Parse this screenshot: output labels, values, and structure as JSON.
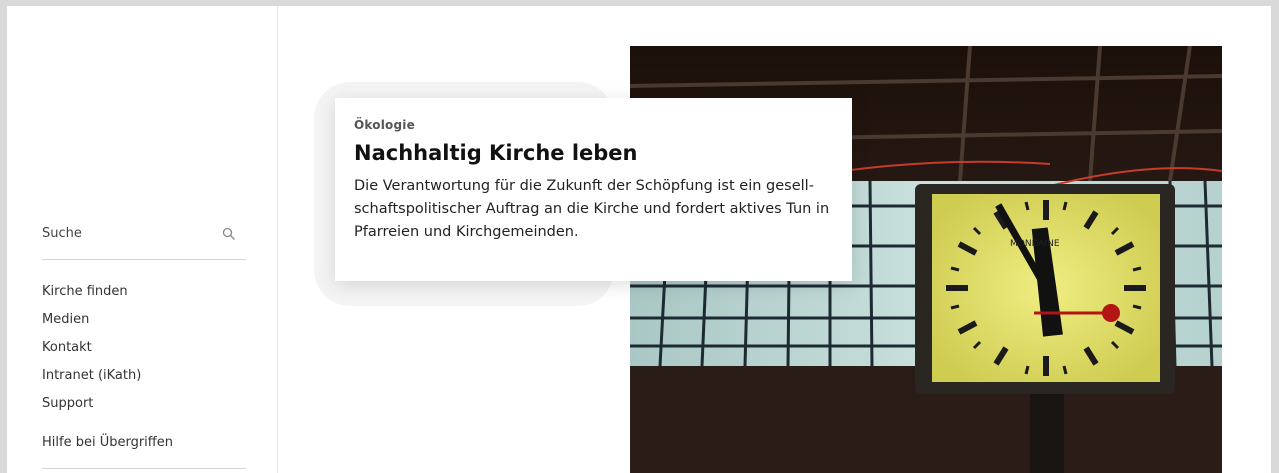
{
  "sidebar": {
    "search": {
      "placeholder": "Suche",
      "icon": "search-icon"
    },
    "nav_items": [
      {
        "label": "Kirche finden"
      },
      {
        "label": "Medien"
      },
      {
        "label": "Kontakt"
      },
      {
        "label": "Intranet (iKath)"
      },
      {
        "label": "Support"
      }
    ],
    "help_link": "Hilfe bei Übergriffen"
  },
  "teaser": {
    "category": "Ökologie",
    "title": "Nachhaltig Kirche leben",
    "text": "Die Verantwortung für die Zukunft der Schöpfung ist ein gesell­schaftspolitischer Auftrag an die Kirche und fordert aktives Tun in Pfarreien und Kirchgemeinden."
  },
  "image": {
    "brand": "MONDAINE",
    "subject": "station clock"
  },
  "colors": {
    "background": "#d9d9d9",
    "panel": "#ffffff",
    "clock_face": "#e2e06a",
    "clock_second_hand": "#b31414"
  }
}
